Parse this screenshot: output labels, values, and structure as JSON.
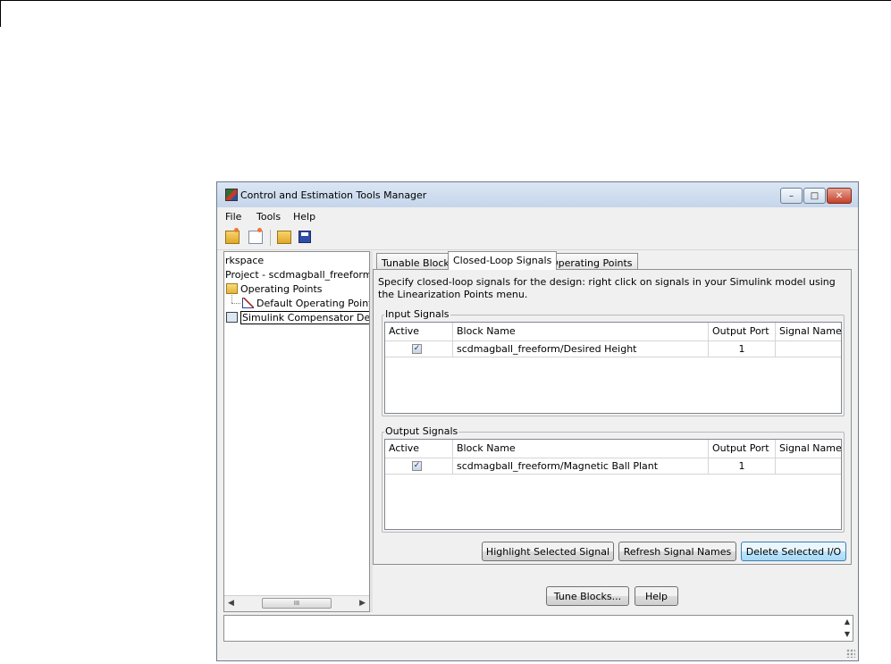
{
  "window": {
    "title": "Control and Estimation Tools Manager",
    "controls": {
      "minimize": "–",
      "maximize": "□",
      "close": "✕"
    }
  },
  "menu": [
    "File",
    "Tools",
    "Help"
  ],
  "toolbar": [
    "new-project-icon",
    "new-task-icon",
    "open-icon",
    "save-icon"
  ],
  "tree": {
    "workspace": "rkspace",
    "project": "Project - scdmagball_freeform",
    "operating_points": "Operating Points",
    "default_op": "Default Operating Point",
    "design": "Simulink Compensator Design",
    "scroll_thumb": "III"
  },
  "tabs": [
    "Tunable Blocks",
    "Closed-Loop Signals",
    "Operating Points"
  ],
  "active_tab": "Closed-Loop Signals",
  "description": "Specify closed-loop signals for the design: right click on signals in your Simulink model using the Linearization Points menu.",
  "columns": [
    "Active",
    "Block Name",
    "Output Port",
    "Signal Name"
  ],
  "input_signals": {
    "label": "Input Signals",
    "rows": [
      {
        "active": true,
        "block": "scdmagball_freeform/Desired Height",
        "port": "1",
        "signal": ""
      }
    ]
  },
  "output_signals": {
    "label": "Output Signals",
    "rows": [
      {
        "active": true,
        "block": "scdmagball_freeform/Magnetic Ball Plant",
        "port": "1",
        "signal": ""
      }
    ]
  },
  "buttons": {
    "highlight": "Highlight Selected Signal",
    "refresh": "Refresh Signal Names",
    "delete": "Delete Selected I/O",
    "tune": "Tune Blocks...",
    "help": "Help"
  },
  "checkmark": "✓",
  "scroll": {
    "left": "◀",
    "right": "▶",
    "up": "▲",
    "down": "▼"
  }
}
